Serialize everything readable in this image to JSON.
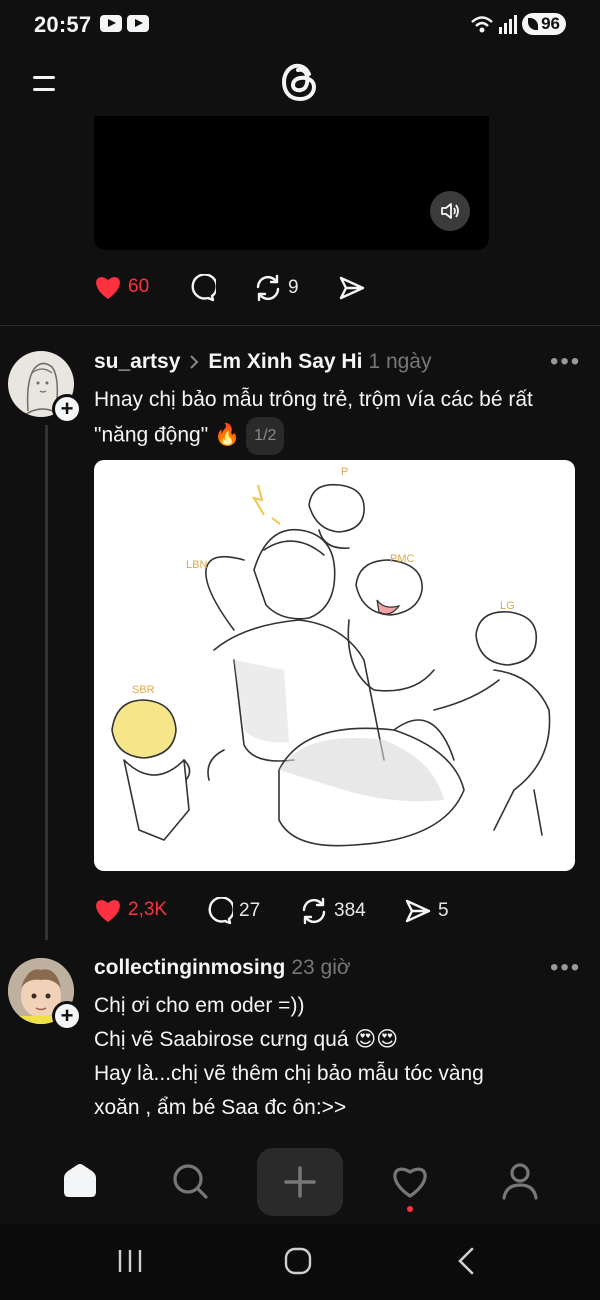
{
  "status_bar": {
    "time": "20:57",
    "battery": "96",
    "icons": [
      "youtube-icon",
      "youtube-icon",
      "wifi-icon",
      "signal-icon",
      "battery-icon"
    ]
  },
  "header": {
    "menu_icon": "menu-icon",
    "logo_icon": "threads-logo-icon"
  },
  "post1": {
    "likes": "60",
    "reposts": "9"
  },
  "post2": {
    "username": "su_artsy",
    "community": "Em Xinh Say Hi",
    "time": "1 ngày",
    "text_line1": "Hnay chị bảo mẫu trông trẻ, trộm vía các bé rất",
    "text_line2": "\"năng động\" 🔥",
    "image_counter": "1/2",
    "image_labels": {
      "p": "P",
      "pmc": "PMC",
      "lbn": "LBN",
      "lg": "LG",
      "sbr": "SBR"
    },
    "likes": "2,3K",
    "comments": "27",
    "reposts": "384",
    "shares": "5"
  },
  "post3": {
    "username": "collectinginmosing",
    "time": "23 giờ",
    "lines": [
      "Chị ơi cho em oder =))",
      "Chị vẽ Saabirose cưng quá 😍😍",
      "Hay là...chị vẽ thêm chị bảo mẫu tóc vàng",
      "xoăn , ẩm bé Saa đc ôn:>>"
    ]
  },
  "bottom_nav": [
    "home-icon",
    "search-icon",
    "compose-icon",
    "activity-icon",
    "profile-icon"
  ],
  "system_nav": [
    "recents-icon",
    "home-circle-icon",
    "back-icon"
  ],
  "colors": {
    "background": "#101010",
    "like_red": "#ff3040",
    "muted": "#777777"
  }
}
